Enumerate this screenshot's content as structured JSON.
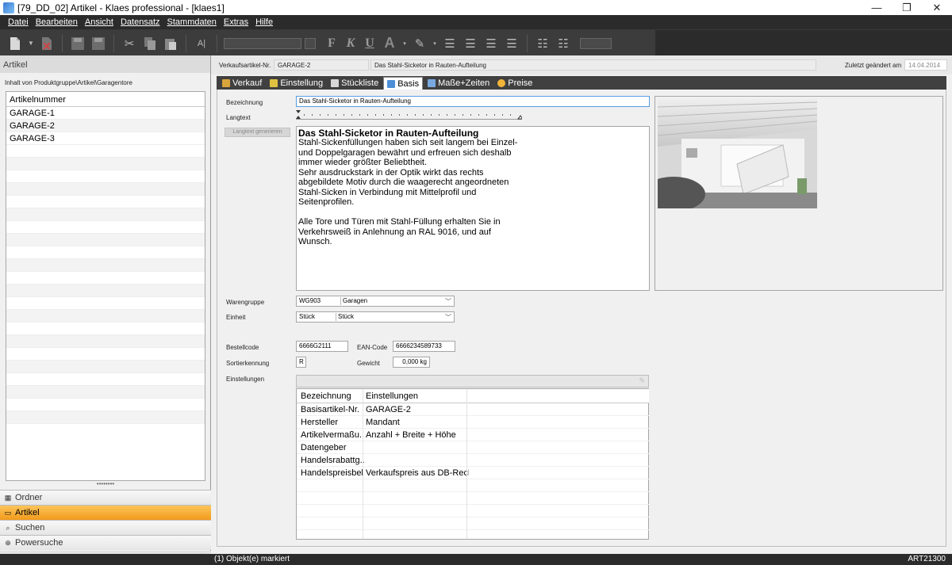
{
  "window": {
    "title": "[79_DD_02] Artikel - Klaes professional - [klaes1]",
    "controls": {
      "minimize": "—",
      "maximize": "❐",
      "close": "✕"
    }
  },
  "menu": [
    "Datei",
    "Bearbeiten",
    "Ansicht",
    "Datensatz",
    "Stammdaten",
    "Extras",
    "Hilfe"
  ],
  "toolbar": {
    "format_bold": "F",
    "format_italic": "K",
    "format_underline": "U"
  },
  "left_panel": {
    "header": "Artikel",
    "path": "Inhalt von Produktgruppe\\Artikel\\Garagentore",
    "column": "Artikelnummer",
    "items": [
      "GARAGE-1",
      "GARAGE-2",
      "GARAGE-3"
    ],
    "nav": [
      "Ordner",
      "Artikel",
      "Suchen",
      "Powersuche"
    ],
    "nav_expander": "»"
  },
  "header": {
    "article_no_label": "Verkaufsartikel-Nr.",
    "article_no": "GARAGE-2",
    "description": "Das Stahl-Sicketor in Rauten-Aufteilung",
    "changed_label": "Zuletzt geändert am",
    "changed_date": "14.04.2014"
  },
  "tabs": [
    "Verkauf",
    "Einstellung",
    "Stückliste",
    "Basis",
    "Maße+Zeiten",
    "Preise"
  ],
  "form": {
    "bezeichnung_label": "Bezeichnung",
    "bezeichnung": "Das Stahl-Sicketor in Rauten-Aufteilung",
    "langtext_label": "Langtext",
    "langtext_button": "Langtext generieren",
    "langtext_title": "Das Stahl-Sicketor in Rauten-Aufteilung",
    "langtext_body": "Stahl-Sickenfüllungen haben sich seit langem bei Einzel-\nund Doppelgaragen bewährt und erfreuen sich deshalb\nimmer wieder größter Beliebtheit.\nSehr ausdruckstark in der Optik wirkt das rechts\nabgebildete Motiv durch die waagerecht angeordneten\nStahl-Sicken in Verbindung mit Mittelprofil und\nSeitenprofilen.\n\nAlle Tore und Türen mit Stahl-Füllung erhalten Sie in\nVerkehrsweiß in Anlehnung an RAL 9016, und auf\nWunsch.",
    "warengruppe_label": "Warengruppe",
    "warengruppe_code": "WG903",
    "warengruppe_name": "Garagen",
    "einheit_label": "Einheit",
    "einheit_code": "Stück",
    "einheit_name": "Stück",
    "bestellcode_label": "Bestellcode",
    "bestellcode": "6666G2111",
    "ean_label": "EAN-Code",
    "ean": "6666234589733",
    "sortier_label": "Sortierkennung",
    "sortier": "R",
    "gewicht_label": "Gewicht",
    "gewicht": "0,000 kg",
    "einstellungen_label": "Einstellungen"
  },
  "settings_grid": {
    "columns": [
      "Bezeichnung",
      "Einstellungen"
    ],
    "rows": [
      [
        "Basisartikel-Nr.",
        "GARAGE-2"
      ],
      [
        "Hersteller",
        "Mandant"
      ],
      [
        "Artikelvermaßu...",
        "Anzahl + Breite + Höhe"
      ],
      [
        "Datengeber",
        ""
      ],
      [
        "Handelsrabattg...",
        ""
      ],
      [
        "Handelspreisbel...",
        "Verkaufspreis aus DB-Rech..."
      ]
    ]
  },
  "status": {
    "left": "(1) Objekt(e) markiert",
    "right": "ART21300"
  }
}
